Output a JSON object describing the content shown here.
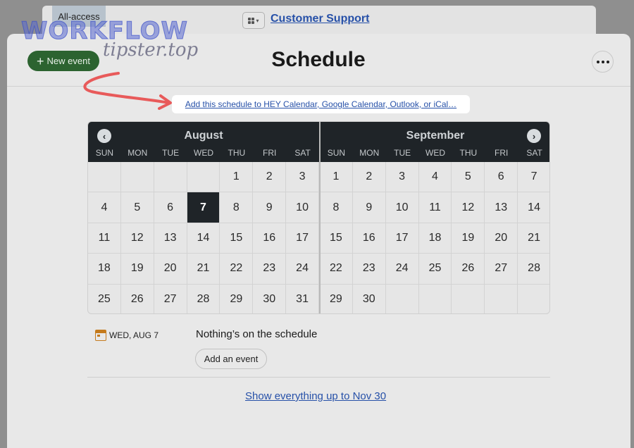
{
  "top_bar": {
    "badge": "All-access",
    "project_title": "Customer Support"
  },
  "watermark": {
    "line1": "WORKFLOW",
    "line2": "tipster.top"
  },
  "header": {
    "new_event_label": "New event",
    "title": "Schedule"
  },
  "subscribe_link": "Add this schedule to HEY Calendar, Google Calendar, Outlook, or iCal…",
  "calendar": {
    "weekdays": [
      "SUN",
      "MON",
      "TUE",
      "WED",
      "THU",
      "FRI",
      "SAT"
    ],
    "months": [
      {
        "name": "August",
        "weeks": [
          [
            "",
            "",
            "",
            "",
            "1",
            "2",
            "3"
          ],
          [
            "4",
            "5",
            "6",
            "7",
            "8",
            "9",
            "10"
          ],
          [
            "11",
            "12",
            "13",
            "14",
            "15",
            "16",
            "17"
          ],
          [
            "18",
            "19",
            "20",
            "21",
            "22",
            "23",
            "24"
          ],
          [
            "25",
            "26",
            "27",
            "28",
            "29",
            "30",
            "31"
          ]
        ],
        "today": "7"
      },
      {
        "name": "September",
        "weeks": [
          [
            "1",
            "2",
            "3",
            "4",
            "5",
            "6",
            "7"
          ],
          [
            "8",
            "9",
            "10",
            "11",
            "12",
            "13",
            "14"
          ],
          [
            "15",
            "16",
            "17",
            "18",
            "19",
            "20",
            "21"
          ],
          [
            "22",
            "23",
            "24",
            "25",
            "26",
            "27",
            "28"
          ],
          [
            "29",
            "30",
            "",
            "",
            "",
            "",
            ""
          ]
        ],
        "today": ""
      }
    ]
  },
  "selected_day": {
    "label": "WED, AUG 7",
    "empty_message": "Nothing’s on the schedule",
    "add_event_label": "Add an event"
  },
  "footer_link": "Show everything up to Nov 30",
  "colors": {
    "accent_green": "#2c6330",
    "link_blue": "#2650a8",
    "calendar_header": "#1f2428",
    "arrow_red": "#e85a5a"
  },
  "icons": {
    "plus": "plus-icon",
    "more": "more-dots-icon",
    "prev": "chevron-left-icon",
    "next": "chevron-right-icon",
    "calendar": "calendar-icon",
    "switcher": "grid-icon"
  }
}
